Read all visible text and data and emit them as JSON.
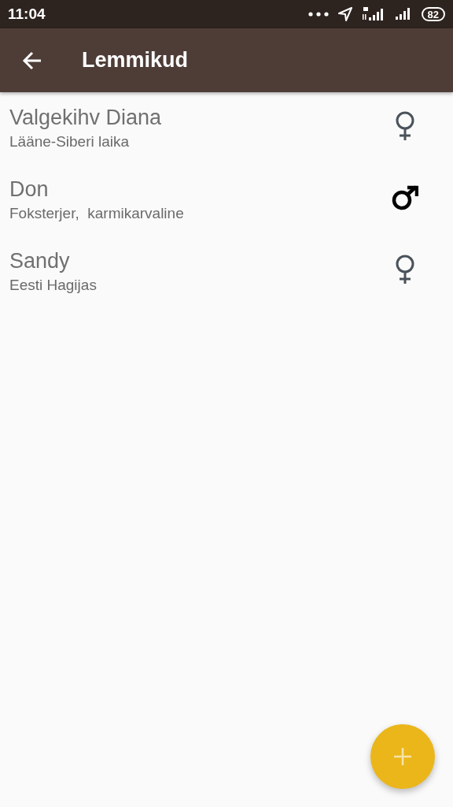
{
  "status_bar": {
    "time": "11:04",
    "battery": "82"
  },
  "app_bar": {
    "title": "Lemmikud"
  },
  "pets": [
    {
      "name": "Valgekihv Diana",
      "breed": "Lääne-Siberi laika",
      "kind": "female"
    },
    {
      "name": "Don",
      "breed": "Foksterjer,  karmikarvaline",
      "kind": "male"
    },
    {
      "name": "Sandy",
      "breed": "Eesti Hagijas",
      "kind": "female"
    }
  ]
}
